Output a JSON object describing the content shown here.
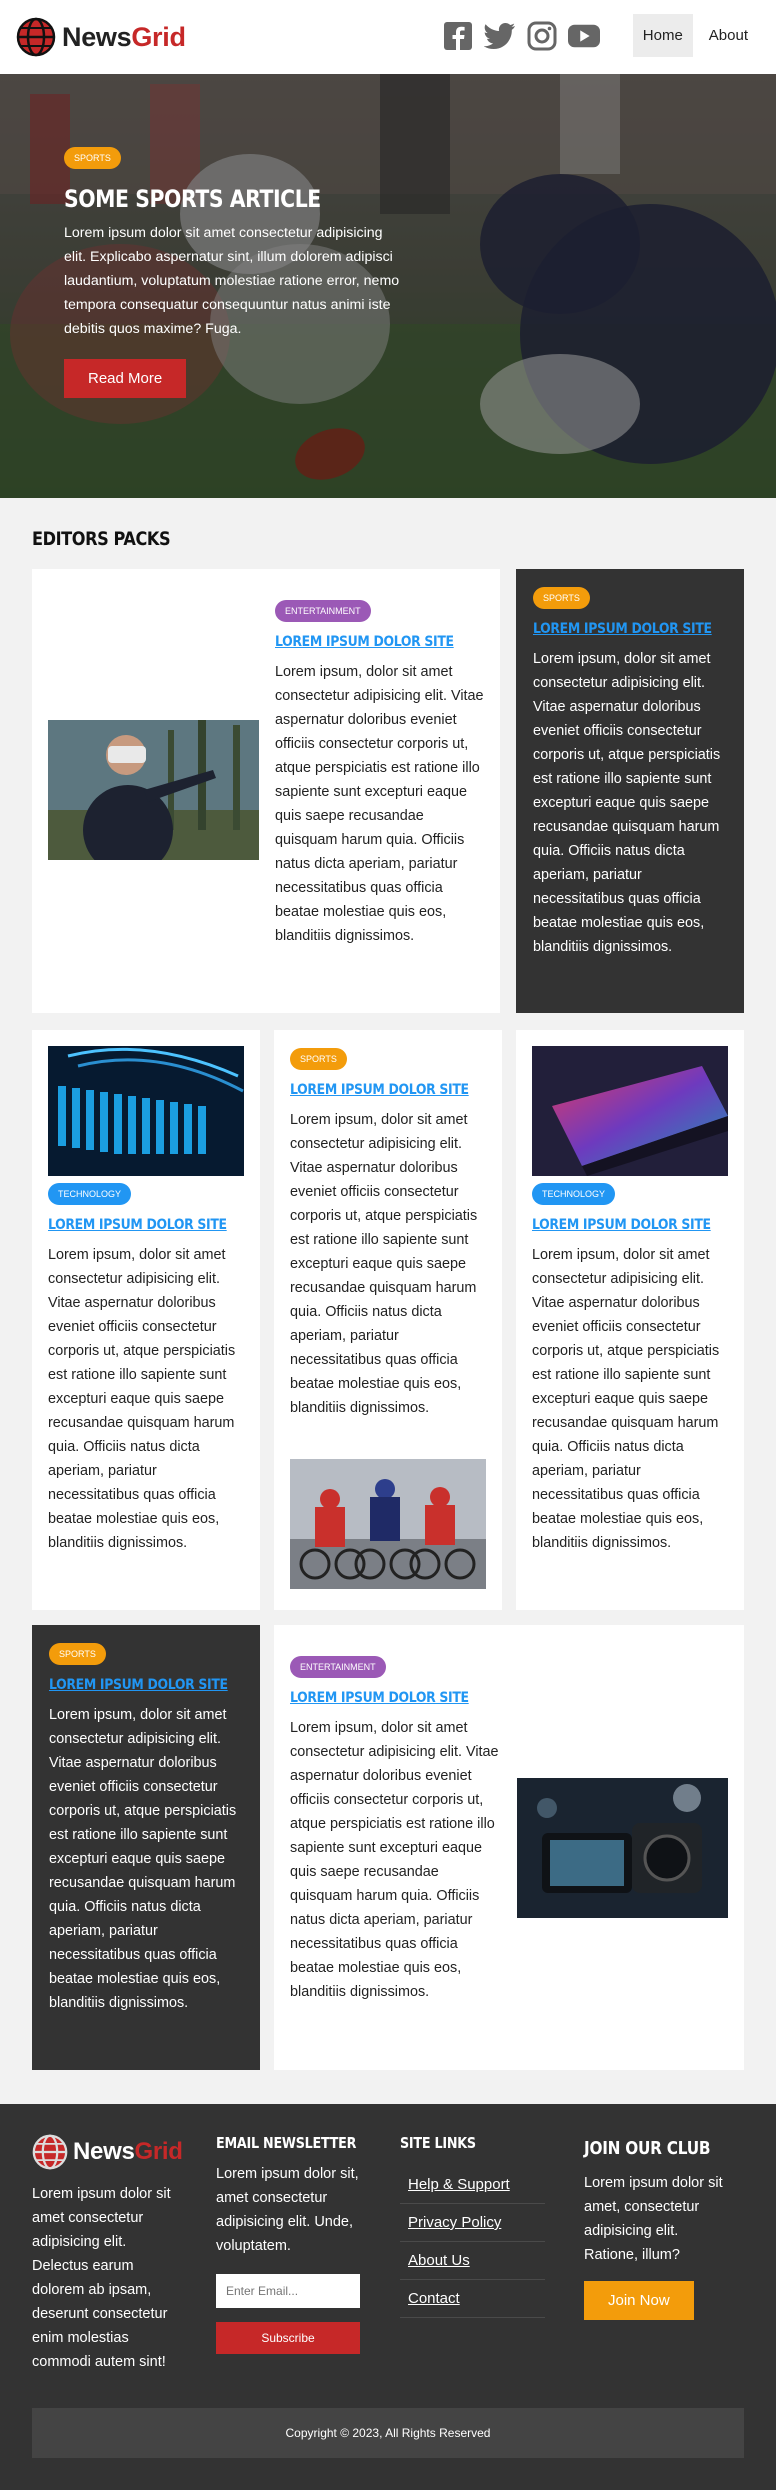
{
  "header": {
    "brand_main": "News",
    "brand_accent": "Grid",
    "social": [
      "facebook-icon",
      "twitter-icon",
      "instagram-icon",
      "youtube-icon"
    ],
    "nav": [
      {
        "label": "Home",
        "active": true
      },
      {
        "label": "About",
        "active": false
      }
    ]
  },
  "hero": {
    "badge": "SPORTS",
    "title": "SOME SPORTS ARTICLE",
    "text": "Lorem ipsum dolor sit amet consectetur adipisicing elit. Explicabo aspernatur sint, illum dolorem adipisci laudantium, voluptatum molestiae ratione error, nemo tempora consequatur consequuntur natus animi iste debitis quos maxime? Fuga.",
    "button": "Read More"
  },
  "editors": {
    "title": "EDITORS PACKS",
    "card_title": "LOREM IPSUM DOLOR SITE",
    "card_text": "Lorem ipsum, dolor sit amet consectetur adipisicing elit. Vitae aspernatur doloribus eveniet officiis consectetur corporis ut, atque perspiciatis est ratione illo sapiente sunt excepturi eaque quis saepe recusandae quisquam harum quia. Officiis natus dicta aperiam, pariatur necessitatibus quas officia beatae molestiae quis eos, blanditiis dignissimos.",
    "badges": {
      "sports": "SPORTS",
      "entertainment": "ENTERTAINMENT",
      "technology": "TECHNOLOGY"
    }
  },
  "footer": {
    "about": "Lorem ipsum dolor sit amet consectetur adipisicing elit. Delectus earum dolorem ab ipsam, deserunt consectetur enim molestias commodi autem sint!",
    "newsletter_title": "EMAIL NEWSLETTER",
    "newsletter_text": "Lorem ipsum dolor sit, amet consectetur adipisicing elit. Unde, voluptatem.",
    "email_placeholder": "Enter Email...",
    "subscribe": "Subscribe",
    "links_title": "SITE LINKS",
    "links": [
      "Help & Support",
      "Privacy Policy",
      "About Us",
      "Contact"
    ],
    "club_title": "JOIN OUR CLUB",
    "club_text": "Lorem ipsum dolor sit amet, consectetur adipisicing elit. Ratione, illum?",
    "join": "Join Now",
    "copyright": "Copyright © 2023, All Rights Reserved"
  }
}
